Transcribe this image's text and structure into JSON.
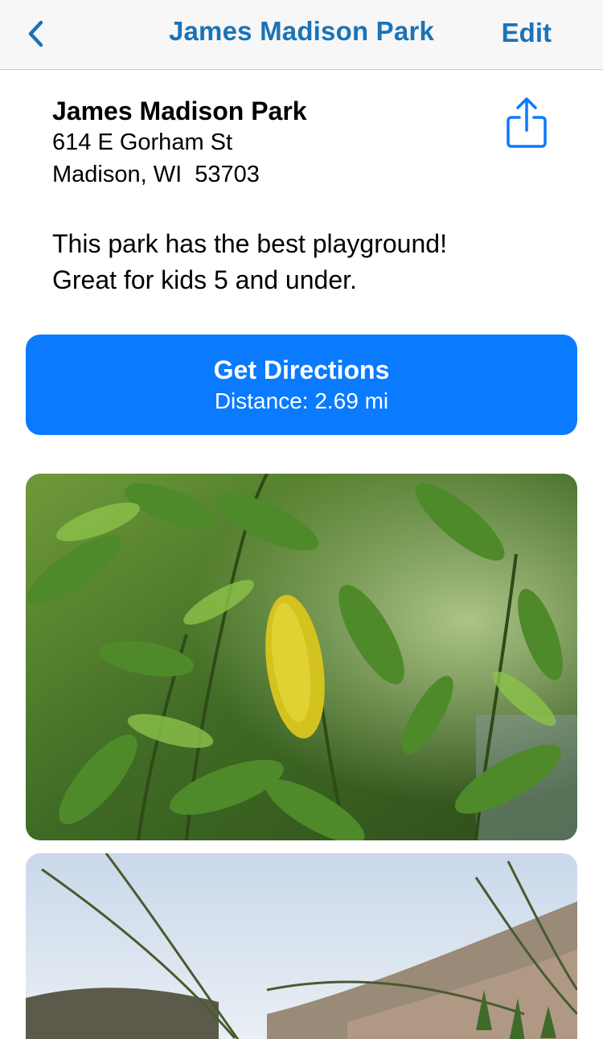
{
  "nav": {
    "title": "James Madison Park",
    "edit_label": "Edit",
    "back_icon": "chevron-left-icon"
  },
  "place": {
    "name": "James Madison Park",
    "address_line1": "614 E Gorham St",
    "address_line2": "Madison, WI  53703",
    "share_icon": "share-icon"
  },
  "description": {
    "line1": "This park has the best playground!",
    "line2": "Great for kids 5 and under."
  },
  "directions": {
    "label": "Get Directions",
    "distance": "Distance: 2.69 mi"
  },
  "photos": [
    {
      "subject": "leaves"
    },
    {
      "subject": "grass"
    }
  ],
  "colors": {
    "accent": "#1a73b8",
    "button": "#0a7aff",
    "navbar": "#f7f7f7"
  }
}
